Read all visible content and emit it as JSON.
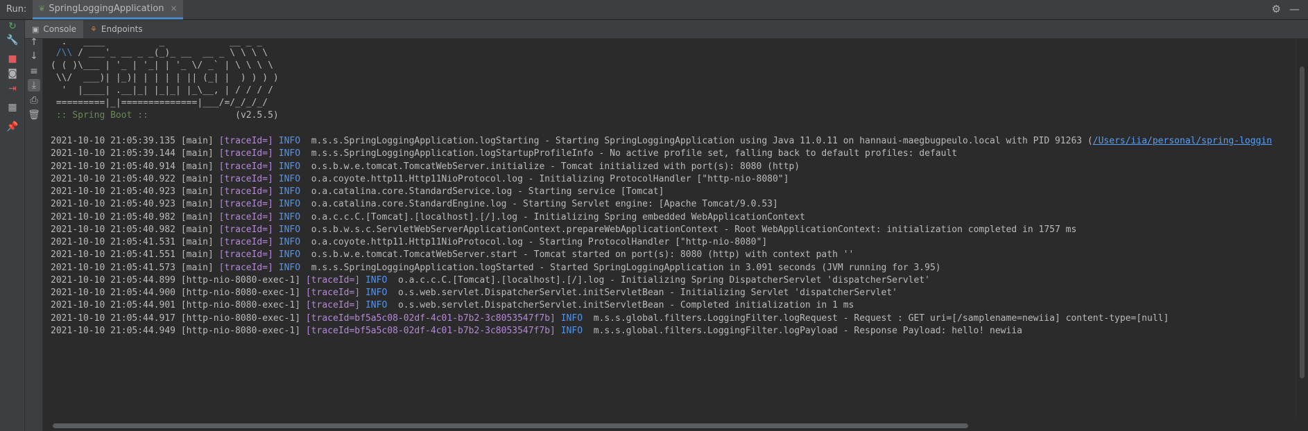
{
  "header": {
    "run_label": "Run:",
    "tab_title": "SpringLoggingApplication",
    "close_glyph": "×"
  },
  "subtabs": [
    {
      "label": "Console",
      "icon": "console-icon"
    },
    {
      "label": "Endpoints",
      "icon": "endpoints-icon"
    }
  ],
  "banner": {
    "ascii": [
      "  .   ____          _            __ _ _",
      " /\\\\ / ___'_ __ _ _(_)_ __  __ _ \\ \\ \\ \\",
      "( ( )\\___ | '_ | '_| | '_ \\/ _` | \\ \\ \\ \\",
      " \\\\/  ___)| |_)| | | | | || (_| |  ) ) ) )",
      "  '  |____| .__|_| |_|_| |_\\__, | / / / /",
      " =========|_|==============|___/=/_/_/_/"
    ],
    "spring_boot_label": " :: Spring Boot :: ",
    "spring_boot_version": "               (v2.5.5)"
  },
  "log": [
    {
      "ts": "2021-10-10 21:05:39.135",
      "thread": "[main]",
      "trace": "[traceId=]",
      "level": "INFO",
      "msg": "m.s.s.SpringLoggingApplication.logStarting - Starting SpringLoggingApplication using Java 11.0.11 on hannaui-maegbugpeulo.local with PID 91263 (",
      "link": "/Users/iia/personal/spring-loggin"
    },
    {
      "ts": "2021-10-10 21:05:39.144",
      "thread": "[main]",
      "trace": "[traceId=]",
      "level": "INFO",
      "msg": "m.s.s.SpringLoggingApplication.logStartupProfileInfo - No active profile set, falling back to default profiles: default"
    },
    {
      "ts": "2021-10-10 21:05:40.914",
      "thread": "[main]",
      "trace": "[traceId=]",
      "level": "INFO",
      "msg": "o.s.b.w.e.tomcat.TomcatWebServer.initialize - Tomcat initialized with port(s): 8080 (http)"
    },
    {
      "ts": "2021-10-10 21:05:40.922",
      "thread": "[main]",
      "trace": "[traceId=]",
      "level": "INFO",
      "msg": "o.a.coyote.http11.Http11NioProtocol.log - Initializing ProtocolHandler [\"http-nio-8080\"]"
    },
    {
      "ts": "2021-10-10 21:05:40.923",
      "thread": "[main]",
      "trace": "[traceId=]",
      "level": "INFO",
      "msg": "o.a.catalina.core.StandardService.log - Starting service [Tomcat]"
    },
    {
      "ts": "2021-10-10 21:05:40.923",
      "thread": "[main]",
      "trace": "[traceId=]",
      "level": "INFO",
      "msg": "o.a.catalina.core.StandardEngine.log - Starting Servlet engine: [Apache Tomcat/9.0.53]"
    },
    {
      "ts": "2021-10-10 21:05:40.982",
      "thread": "[main]",
      "trace": "[traceId=]",
      "level": "INFO",
      "msg": "o.a.c.c.C.[Tomcat].[localhost].[/].log - Initializing Spring embedded WebApplicationContext"
    },
    {
      "ts": "2021-10-10 21:05:40.982",
      "thread": "[main]",
      "trace": "[traceId=]",
      "level": "INFO",
      "msg": "o.s.b.w.s.c.ServletWebServerApplicationContext.prepareWebApplicationContext - Root WebApplicationContext: initialization completed in 1757 ms"
    },
    {
      "ts": "2021-10-10 21:05:41.531",
      "thread": "[main]",
      "trace": "[traceId=]",
      "level": "INFO",
      "msg": "o.a.coyote.http11.Http11NioProtocol.log - Starting ProtocolHandler [\"http-nio-8080\"]"
    },
    {
      "ts": "2021-10-10 21:05:41.551",
      "thread": "[main]",
      "trace": "[traceId=]",
      "level": "INFO",
      "msg": "o.s.b.w.e.tomcat.TomcatWebServer.start - Tomcat started on port(s): 8080 (http) with context path ''"
    },
    {
      "ts": "2021-10-10 21:05:41.573",
      "thread": "[main]",
      "trace": "[traceId=]",
      "level": "INFO",
      "msg": "m.s.s.SpringLoggingApplication.logStarted - Started SpringLoggingApplication in 3.091 seconds (JVM running for 3.95)"
    },
    {
      "ts": "2021-10-10 21:05:44.899",
      "thread": "[http-nio-8080-exec-1]",
      "trace": "[traceId=]",
      "level": "INFO",
      "msg": "o.a.c.c.C.[Tomcat].[localhost].[/].log - Initializing Spring DispatcherServlet 'dispatcherServlet'"
    },
    {
      "ts": "2021-10-10 21:05:44.900",
      "thread": "[http-nio-8080-exec-1]",
      "trace": "[traceId=]",
      "level": "INFO",
      "msg": "o.s.web.servlet.DispatcherServlet.initServletBean - Initializing Servlet 'dispatcherServlet'"
    },
    {
      "ts": "2021-10-10 21:05:44.901",
      "thread": "[http-nio-8080-exec-1]",
      "trace": "[traceId=]",
      "level": "INFO",
      "msg": "o.s.web.servlet.DispatcherServlet.initServletBean - Completed initialization in 1 ms"
    },
    {
      "ts": "2021-10-10 21:05:44.917",
      "thread": "[http-nio-8080-exec-1]",
      "trace": "[traceId=bf5a5c08-02df-4c01-b7b2-3c8053547f7b]",
      "level": "INFO",
      "msg": "m.s.s.global.filters.LoggingFilter.logRequest - Request : GET uri=[/samplename=newiia] content-type=[null]"
    },
    {
      "ts": "2021-10-10 21:05:44.949",
      "thread": "[http-nio-8080-exec-1]",
      "trace": "[traceId=bf5a5c08-02df-4c01-b7b2-3c8053547f7b]",
      "level": "INFO",
      "msg": "m.s.s.global.filters.LoggingFilter.logPayload - Response Payload: hello! newiia"
    }
  ],
  "colors": {
    "background": "#2b2b2b",
    "text": "#bbbbbb",
    "trace": "#b589d6",
    "level": "#5394ec",
    "spring_label": "#6a8759",
    "link": "#589df6"
  }
}
